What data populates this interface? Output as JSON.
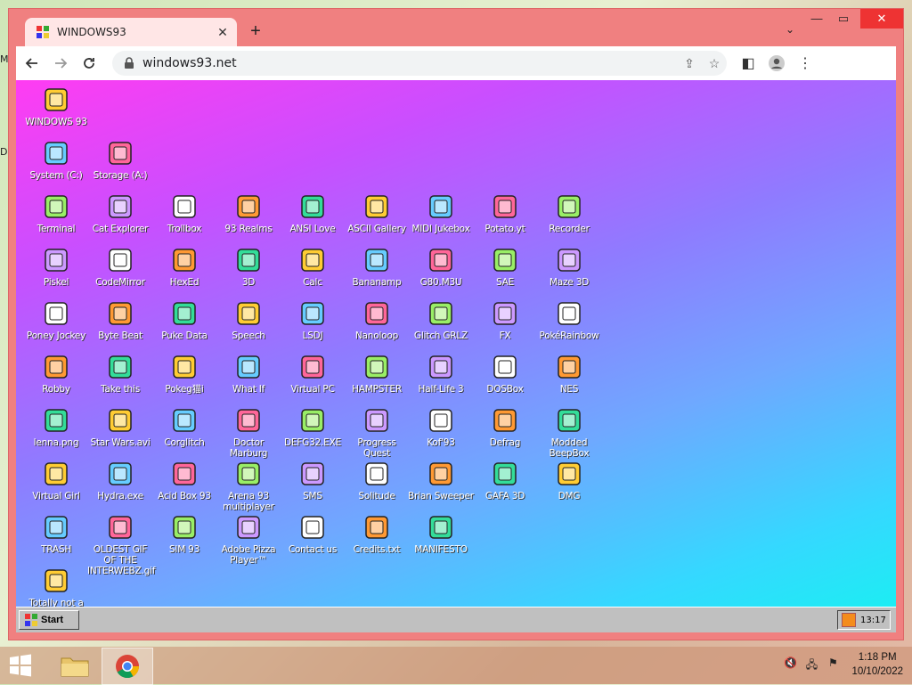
{
  "host": {
    "edge_label_1": "M",
    "edge_label_2": "D",
    "taskbar": {
      "time": "1:18 PM",
      "date": "10/10/2022"
    }
  },
  "browser": {
    "tab_title": "WINDOWS93",
    "url": "windows93.net",
    "accent": "#f08080"
  },
  "w93": {
    "start_label": "Start",
    "clock": "13:17",
    "icons": [
      {
        "label": "WINDOWS 93",
        "icon": "computer-icon"
      },
      {
        "label": "System (C:)",
        "icon": "hard-drive-icon"
      },
      {
        "label": "Storage (A:)",
        "icon": "floppy-drive-icon"
      },
      {
        "label": "Terminal",
        "icon": "terminal-icon"
      },
      {
        "label": "Cat Explorer",
        "icon": "globe-icon"
      },
      {
        "label": "Trollbox",
        "icon": "chat-icon"
      },
      {
        "label": "93 Realms",
        "icon": "knight-icon"
      },
      {
        "label": "ANSI Love",
        "icon": "ansi-icon"
      },
      {
        "label": "ASCII Gallery",
        "icon": "numbers-icon"
      },
      {
        "label": "MIDI Jukebox",
        "icon": "piano-icon"
      },
      {
        "label": "Potato.yt",
        "icon": "potato-icon"
      },
      {
        "label": "Recorder",
        "icon": "microphone-icon"
      },
      {
        "label": "Piskel",
        "icon": "palette-icon"
      },
      {
        "label": "CodeMirror",
        "icon": "codemirror-icon"
      },
      {
        "label": "HexEd",
        "icon": "cube-icon"
      },
      {
        "label": "3D",
        "icon": "teapot-icon"
      },
      {
        "label": "Calc",
        "icon": "calculator-icon"
      },
      {
        "label": "Bananamp",
        "icon": "banana-icon"
      },
      {
        "label": "G80.M3U",
        "icon": "playlist-icon"
      },
      {
        "label": "SAE",
        "icon": "boing-ball-icon"
      },
      {
        "label": "Maze 3D",
        "icon": "maze-icon"
      },
      {
        "label": "Poney Jockey",
        "icon": "pony-icon"
      },
      {
        "label": "Byte Beat",
        "icon": "bytebeat-icon"
      },
      {
        "label": "Puke Data",
        "icon": "pd-icon"
      },
      {
        "label": "Speech",
        "icon": "speech-icon"
      },
      {
        "label": "LSDJ",
        "icon": "lsdj-icon"
      },
      {
        "label": "Nanoloop",
        "icon": "wave-icon"
      },
      {
        "label": "Glitch GRLZ",
        "icon": "lips-icon"
      },
      {
        "label": "FX",
        "icon": "atom-icon"
      },
      {
        "label": "PokéRainbow",
        "icon": "characters-icon"
      },
      {
        "label": "Robby",
        "icon": "stick-figure-icon"
      },
      {
        "label": "Take this",
        "icon": "monster-icon"
      },
      {
        "label": "Pokeg猫i",
        "icon": "pokeg-icon"
      },
      {
        "label": "What If",
        "icon": "matrix-icon"
      },
      {
        "label": "Virtual PC",
        "icon": "virtual-pc-icon"
      },
      {
        "label": "HAMPSTER",
        "icon": "owl-icon"
      },
      {
        "label": "Half-Life 3",
        "icon": "lambda-icon"
      },
      {
        "label": "DOSBox",
        "icon": "dosbox-icon"
      },
      {
        "label": "NES",
        "icon": "nes-icon"
      },
      {
        "label": "lenna.png",
        "icon": "image-file-icon"
      },
      {
        "label": "Star Wars.avi",
        "icon": "yoda-icon"
      },
      {
        "label": "Corglitch",
        "icon": "corgi-icon"
      },
      {
        "label": "Doctor Marburg",
        "icon": "doctor-icon"
      },
      {
        "label": "DEFG32.EXE",
        "icon": "defg-icon"
      },
      {
        "label": "Progress Quest",
        "icon": "crossed-swords-icon"
      },
      {
        "label": "Kof'93",
        "icon": "fighter-icon"
      },
      {
        "label": "Defrag",
        "icon": "defrag-icon"
      },
      {
        "label": "Modded BeepBox",
        "icon": "ring-icon"
      },
      {
        "label": "Virtual Girl",
        "icon": "face-icon"
      },
      {
        "label": "Hydra.exe",
        "icon": "dragon-icon"
      },
      {
        "label": "Acid Box 93",
        "icon": "smiley-icon"
      },
      {
        "label": "Arena 93 multiplayer",
        "icon": "arena-cube-icon"
      },
      {
        "label": "SMS",
        "icon": "console-icon"
      },
      {
        "label": "Solitude",
        "icon": "bottle-icon"
      },
      {
        "label": "Brian Sweeper",
        "icon": "mine-icon"
      },
      {
        "label": "GAFA 3D",
        "icon": "head-icon"
      },
      {
        "label": "DMG",
        "icon": "gameboy-icon"
      },
      {
        "label": "TRASH",
        "icon": "trash-icon"
      },
      {
        "label": "OLDEST GIF OF THE INTERWEBZ.gif",
        "icon": "gif-file-icon"
      },
      {
        "label": "SIM 93",
        "icon": "book-icon"
      },
      {
        "label": "Adobe Pizza Player™",
        "icon": "pizza-icon"
      },
      {
        "label": "Contact us",
        "icon": "contact-icon"
      },
      {
        "label": "Credits.txt",
        "icon": "text-file-icon"
      },
      {
        "label": "MANIFESTO",
        "icon": "question-icon"
      },
      {
        "label": "Totally not a",
        "icon": "dolphin-icon"
      }
    ]
  }
}
